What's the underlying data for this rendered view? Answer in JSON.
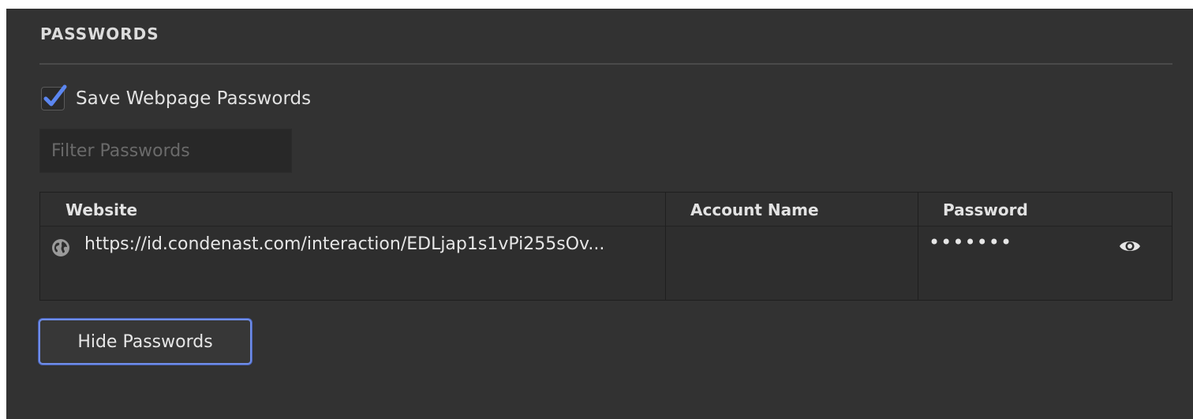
{
  "section": {
    "title": "PASSWORDS"
  },
  "save_passwords": {
    "label": "Save Webpage Passwords",
    "checked": true
  },
  "filter": {
    "placeholder": "Filter Passwords",
    "value": ""
  },
  "table": {
    "columns": [
      "Website",
      "Account Name",
      "Password"
    ],
    "rows": [
      {
        "website": "https://id.condenast.com/interaction/EDLjap1s1vPi255sOv...",
        "account_name": "",
        "password": "•••••••"
      }
    ]
  },
  "hide_button": {
    "label": "Hide Passwords"
  },
  "colors": {
    "panel_bg": "#323232",
    "accent": "#6f8de8",
    "checkmark": "#5b86f0"
  },
  "icons": {
    "site": "globe-icon",
    "reveal": "eye-icon",
    "check": "checkmark-icon"
  }
}
